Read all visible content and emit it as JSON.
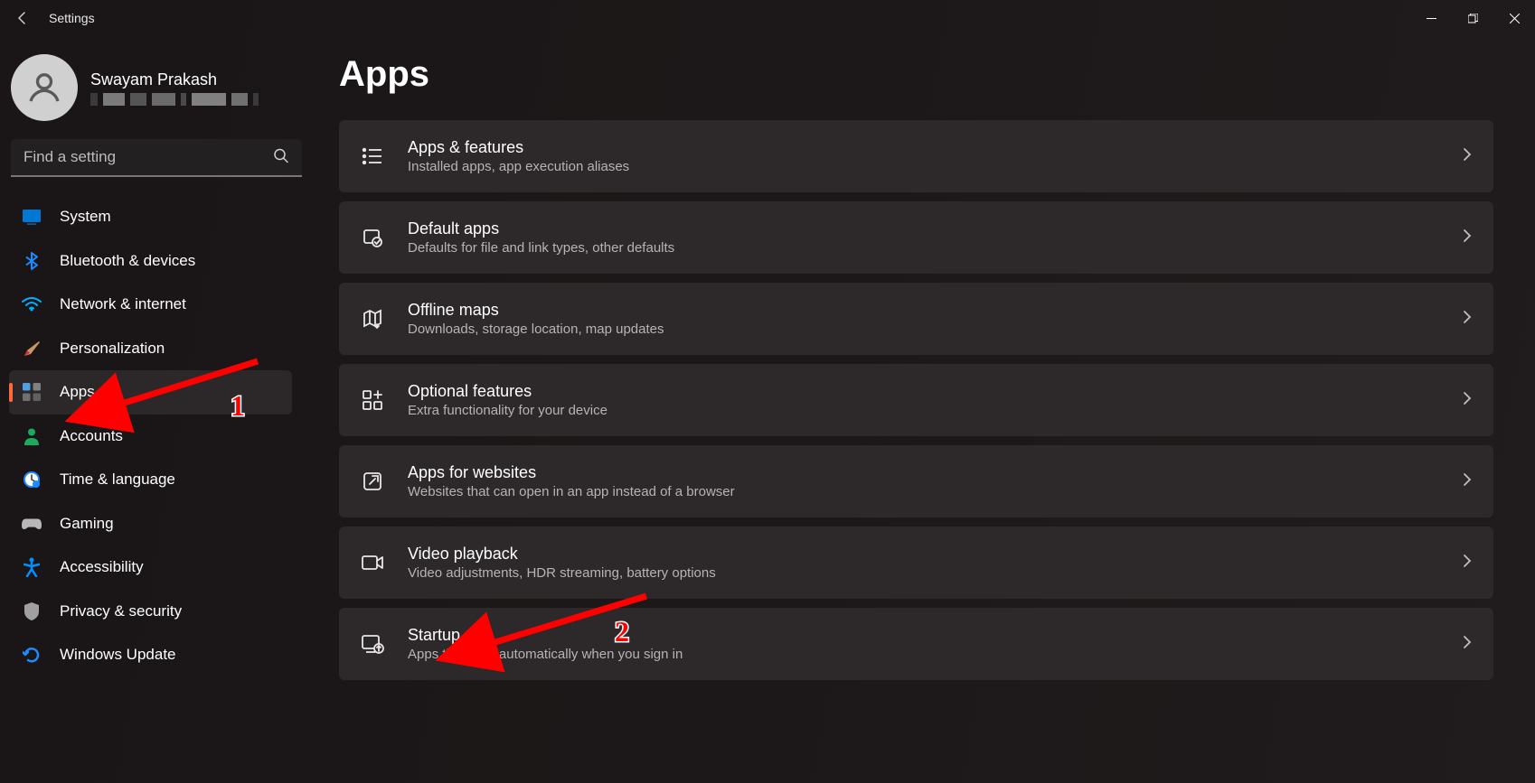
{
  "window_title": "Settings",
  "user": {
    "name": "Swayam Prakash"
  },
  "search": {
    "placeholder": "Find a setting"
  },
  "sidebar": {
    "items": [
      {
        "label": "System"
      },
      {
        "label": "Bluetooth & devices"
      },
      {
        "label": "Network & internet"
      },
      {
        "label": "Personalization"
      },
      {
        "label": "Apps"
      },
      {
        "label": "Accounts"
      },
      {
        "label": "Time & language"
      },
      {
        "label": "Gaming"
      },
      {
        "label": "Accessibility"
      },
      {
        "label": "Privacy & security"
      },
      {
        "label": "Windows Update"
      }
    ]
  },
  "page": {
    "title": "Apps",
    "cards": [
      {
        "title": "Apps & features",
        "sub": "Installed apps, app execution aliases"
      },
      {
        "title": "Default apps",
        "sub": "Defaults for file and link types, other defaults"
      },
      {
        "title": "Offline maps",
        "sub": "Downloads, storage location, map updates"
      },
      {
        "title": "Optional features",
        "sub": "Extra functionality for your device"
      },
      {
        "title": "Apps for websites",
        "sub": "Websites that can open in an app instead of a browser"
      },
      {
        "title": "Video playback",
        "sub": "Video adjustments, HDR streaming, battery options"
      },
      {
        "title": "Startup",
        "sub": "Apps that start automatically when you sign in"
      }
    ]
  },
  "annotations": {
    "one": "1",
    "two": "2"
  }
}
